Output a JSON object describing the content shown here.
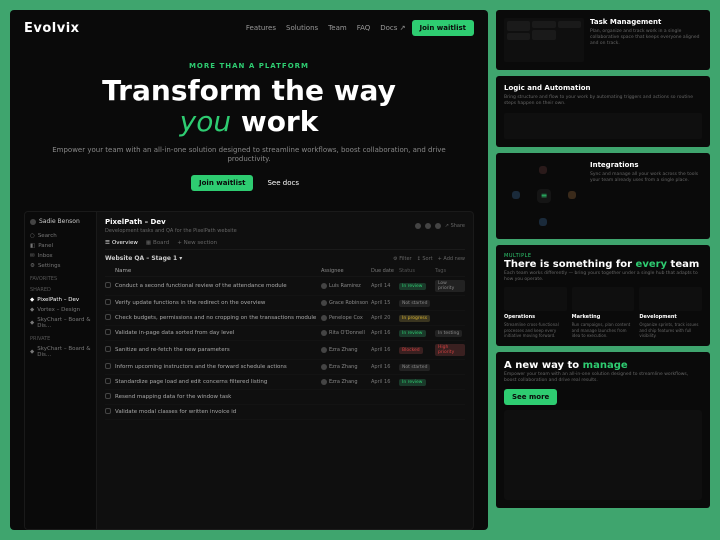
{
  "nav": {
    "logo": "Evolvix",
    "links": [
      "Features",
      "Solutions",
      "Team",
      "FAQ",
      "Docs ↗"
    ],
    "cta": "Join waitlist"
  },
  "hero": {
    "eyebrow": "MORE THAN A PLATFORM",
    "title_1": "Transform the way",
    "title_accent": "you",
    "title_2": " work",
    "subtitle": "Empower your team with an all-in-one solution designed to streamline workflows, boost collaboration, and drive productivity.",
    "cta_primary": "Join waitlist",
    "cta_secondary": "See docs"
  },
  "app": {
    "sidebar": {
      "user": "Sadie Benson",
      "items_top": [
        "Search",
        "Panel",
        "Inbox",
        "Settings"
      ],
      "section_favorites": "Favorites",
      "section_shared": "Shared",
      "shared_items": [
        "PixelPath – Dev",
        "Vortex – Design",
        "SkyChart – Board & Dis..."
      ],
      "section_private": "Private",
      "private_items": [
        "SkyChart – Board & Dis..."
      ]
    },
    "content": {
      "title": "PixelPath – Dev",
      "subtitle": "Development tasks and QA for the PixelPath website",
      "share": "Share",
      "tabs": [
        "Overview",
        "Board"
      ],
      "add_section": "+ New section",
      "stage": "Website QA – Stage 1",
      "stage_actions": [
        "Filter",
        "Sort",
        "Add new"
      ],
      "columns": [
        "Name",
        "Assignee",
        "Due date",
        "Status",
        "Tags"
      ],
      "rows": [
        {
          "name": "Conduct a second functional review of the attendance module",
          "assignee": "Luis Ramirez",
          "date": "April 14",
          "status": "In review",
          "statusClass": "green",
          "tag": "Low priority",
          "tagClass": "gray"
        },
        {
          "name": "Verify update functions in the redirect on the overview",
          "assignee": "Grace Robinson",
          "date": "April 15",
          "status": "Not started",
          "statusClass": "gray",
          "tag": "",
          "tagClass": ""
        },
        {
          "name": "Check budgets, permissions and no cropping on the transactions module",
          "assignee": "Penelope Cox",
          "date": "April 20",
          "status": "In progress",
          "statusClass": "yellow",
          "tag": "",
          "tagClass": ""
        },
        {
          "name": "Validate in-page data sorted from day level",
          "assignee": "Rita O'Donnell",
          "date": "April 16",
          "status": "In review",
          "statusClass": "green",
          "tag": "In testing",
          "tagClass": "gray"
        },
        {
          "name": "Sanitize and re-fetch the new parameters",
          "assignee": "Ezra Zhang",
          "date": "April 16",
          "status": "Blocked",
          "statusClass": "red",
          "tag": "High priority",
          "tagClass": "red"
        },
        {
          "name": "Inform upcoming instructors and the forward schedule actions",
          "assignee": "Ezra Zhang",
          "date": "April 16",
          "status": "Not started",
          "statusClass": "gray",
          "tag": "",
          "tagClass": ""
        },
        {
          "name": "Standardize page load and edit concerns filtered listing",
          "assignee": "Ezra Zhang",
          "date": "April 16",
          "status": "In review",
          "statusClass": "green",
          "tag": "",
          "tagClass": ""
        },
        {
          "name": "Resend mapping data for the window task",
          "assignee": "",
          "date": "",
          "status": "",
          "statusClass": "",
          "tag": "",
          "tagClass": ""
        },
        {
          "name": "Validate modal classes for written invoice id",
          "assignee": "",
          "date": "",
          "status": "",
          "statusClass": "",
          "tag": "",
          "tagClass": ""
        }
      ]
    }
  },
  "side": {
    "feat1": {
      "title": "Task Management",
      "desc": "Plan, organize and track work in a single collaborative space that keeps everyone aligned and on track."
    },
    "feat2": {
      "title": "Logic and Automation",
      "desc": "Bring structure and flow to your work by automating triggers and actions so routine steps happen on their own."
    },
    "feat3": {
      "title": "Integrations",
      "desc": "Sync and manage all your work across the tools your team already uses from a single place."
    },
    "something": {
      "eyebrow": "MULTIPLE",
      "title_1": "There is something for ",
      "accent": "every",
      "title_2": " team",
      "desc": "Each team works differently — bring yours together under a single hub that adapts to how you operate.",
      "cols": [
        {
          "title": "Operations",
          "desc": "Streamline cross-functional processes and keep every initiative moving forward."
        },
        {
          "title": "Marketing",
          "desc": "Run campaigns, plan content and manage launches from idea to execution."
        },
        {
          "title": "Development",
          "desc": "Organize sprints, track issues and ship features with full visibility."
        }
      ]
    },
    "manage": {
      "title_1": "A new way to ",
      "accent": "manage",
      "desc": "Empower your team with an all-in-one solution designed to streamline workflows, boost collaboration and drive real results.",
      "cta": "See more"
    }
  }
}
